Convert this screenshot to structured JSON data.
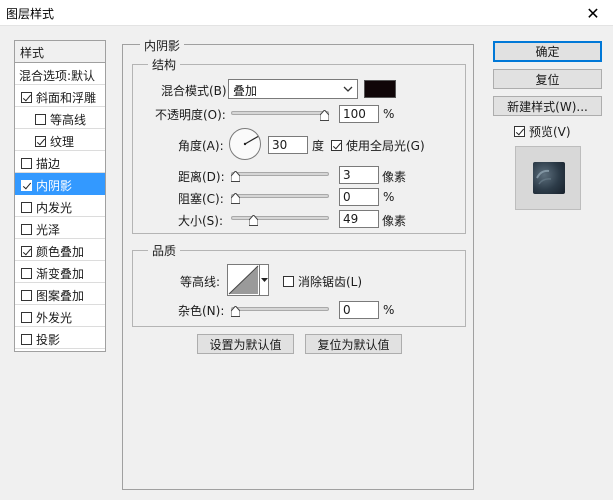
{
  "window": {
    "title": "图层样式",
    "close": "✕"
  },
  "stylelist": {
    "header": "样式",
    "blend_options": "混合选项:默认",
    "items": [
      {
        "label": "斜面和浮雕",
        "checked": true,
        "sub": false,
        "selected": false
      },
      {
        "label": "等高线",
        "checked": false,
        "sub": true,
        "selected": false
      },
      {
        "label": "纹理",
        "checked": true,
        "sub": true,
        "selected": false
      },
      {
        "label": "描边",
        "checked": false,
        "sub": false,
        "selected": false
      },
      {
        "label": "内阴影",
        "checked": true,
        "sub": false,
        "selected": true
      },
      {
        "label": "内发光",
        "checked": false,
        "sub": false,
        "selected": false
      },
      {
        "label": "光泽",
        "checked": false,
        "sub": false,
        "selected": false
      },
      {
        "label": "颜色叠加",
        "checked": true,
        "sub": false,
        "selected": false
      },
      {
        "label": "渐变叠加",
        "checked": false,
        "sub": false,
        "selected": false
      },
      {
        "label": "图案叠加",
        "checked": false,
        "sub": false,
        "selected": false
      },
      {
        "label": "外发光",
        "checked": false,
        "sub": false,
        "selected": false
      },
      {
        "label": "投影",
        "checked": false,
        "sub": false,
        "selected": false
      }
    ]
  },
  "inner_shadow": {
    "title": "内阴影",
    "structure": {
      "title": "结构",
      "blend_mode_label": "混合模式(B):",
      "blend_mode_value": "叠加",
      "shadow_color": "#100608",
      "opacity_label": "不透明度(O):",
      "opacity_value": "100",
      "opacity_unit": "%",
      "angle_label": "角度(A):",
      "angle_value": "30",
      "angle_unit": "度",
      "global_light_label": "使用全局光(G)",
      "global_light_checked": true,
      "distance_label": "距离(D):",
      "distance_value": "3",
      "distance_unit": "像素",
      "choke_label": "阻塞(C):",
      "choke_value": "0",
      "choke_unit": "%",
      "size_label": "大小(S):",
      "size_value": "49",
      "size_unit": "像素"
    },
    "quality": {
      "title": "品质",
      "contour_label": "等高线:",
      "anti_alias_label": "消除锯齿(L)",
      "anti_alias_checked": false,
      "noise_label": "杂色(N):",
      "noise_value": "0",
      "noise_unit": "%"
    },
    "set_default": "设置为默认值",
    "reset_default": "复位为默认值"
  },
  "buttons": {
    "ok": "确定",
    "reset": "复位",
    "new_style": "新建样式(W)...",
    "preview_label": "预览(V)",
    "preview_checked": true
  },
  "sliders": {
    "opacity": 1.0,
    "distance": 0.0,
    "choke": 0.0,
    "size": 0.2,
    "noise": 0.0
  }
}
